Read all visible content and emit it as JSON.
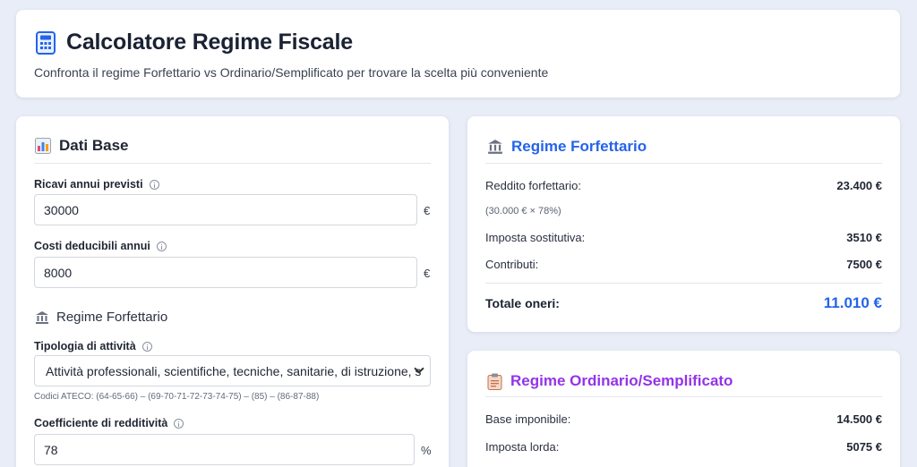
{
  "header": {
    "title": "Calcolatore Regime Fiscale",
    "subtitle": "Confronta il regime Forfettario vs Ordinario/Semplificato per trovare la scelta più conveniente"
  },
  "left": {
    "section_title": "Dati Base",
    "revenue": {
      "label": "Ricavi annui previsti",
      "value": "30000",
      "unit": "€"
    },
    "costs": {
      "label": "Costi deducibili annui",
      "value": "8000",
      "unit": "€"
    },
    "forfettario_title": "Regime Forfettario",
    "activity": {
      "label": "Tipologia di attività",
      "selected": "Attività professionali, scientifiche, tecniche, sanitarie, di istruzione, s",
      "hint": "Codici ATECO: (64-65-66) – (69-70-71-72-73-74-75) – (85) – (86-87-88)"
    },
    "coefficient": {
      "label": "Coefficiente di redditività",
      "value": "78",
      "unit": "%"
    }
  },
  "forfettario": {
    "title": "Regime Forfettario",
    "rows": [
      {
        "label": "Reddito forfettario:",
        "value": "23.400 €"
      },
      {
        "label": "Imposta sostitutiva:",
        "value": "3510 €"
      },
      {
        "label": "Contributi:",
        "value": "7500 €"
      }
    ],
    "note": "(30.000 € × 78%)",
    "total_label": "Totale oneri:",
    "total_value": "11.010 €"
  },
  "ordinario": {
    "title": "Regime Ordinario/Semplificato",
    "rows": [
      {
        "label": "Base imponibile:",
        "value": "14.500 €"
      },
      {
        "label": "Imposta lorda:",
        "value": "5075 €"
      }
    ]
  },
  "colors": {
    "forfettario_accent": "#2563eb",
    "ordinario_accent": "#9333ea"
  },
  "icons": {
    "header": "calculator-icon",
    "dati_base": "bar-chart-icon",
    "forfettario": "bank-icon",
    "ordinario": "clipboard-icon"
  }
}
